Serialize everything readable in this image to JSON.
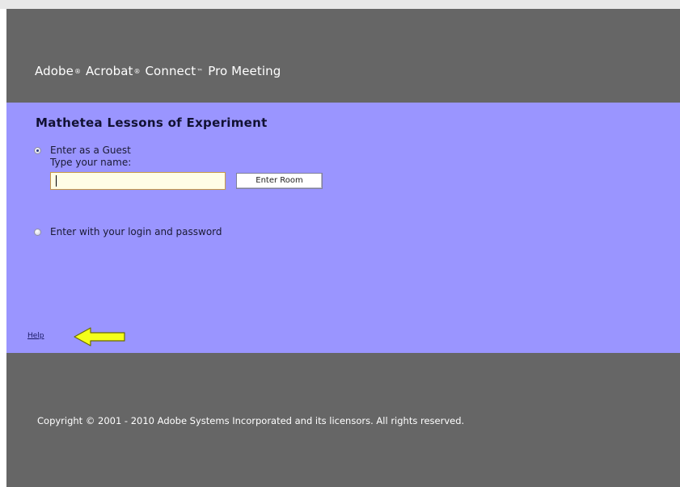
{
  "header": {
    "brand_adobe": "Adobe",
    "brand_acrobat": "Acrobat",
    "brand_rest": "Connect",
    "brand_tail": "Pro Meeting",
    "reg_mark": "®",
    "tm_mark": "™"
  },
  "login_panel": {
    "meeting_title": "Mathetea Lessons of Experiment",
    "guest_option": {
      "label": "Enter as a Guest",
      "selected": true
    },
    "name_prompt": "Type your name:",
    "name_input": {
      "value": "",
      "placeholder": ""
    },
    "enter_button_label": "Enter Room",
    "login_option": {
      "label": "Enter with your login and password",
      "selected": false
    },
    "help_link": "Help",
    "annotation_arrow_color": "#f4ff1a"
  },
  "footer": {
    "copyright": "Copyright © 2001 - 2010 Adobe Systems Incorporated and its licensors. All rights reserved."
  },
  "colors": {
    "header_bg": "#666666",
    "panel_bg": "#9a95ff",
    "footer_bg": "#666666",
    "input_border": "#c89a44"
  }
}
